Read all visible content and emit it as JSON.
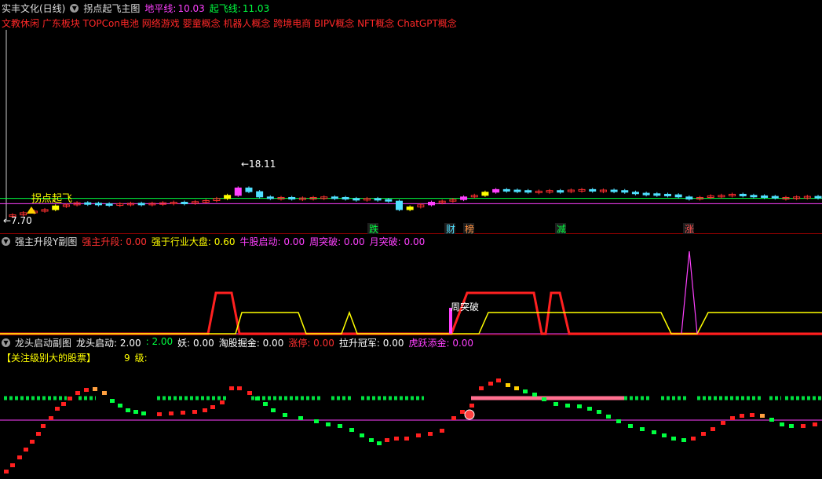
{
  "panel1": {
    "stock_title": "实丰文化(日线)",
    "indicator_name": "拐点起飞主图",
    "lbl1": "地平线:",
    "val1": "10.03",
    "lbl2": "起飞线:",
    "val2": "11.03",
    "concepts": "文教休闲 广东板块 TOPCon电池 网络游戏 婴童概念 机器人概念 跨境电商 BIPV概念 NFT概念 ChatGPT概念",
    "signal_label": "拐点起飞",
    "high_label": "18.11",
    "low_label": "7.70",
    "markers": [
      "跌",
      "财",
      "榜",
      "减",
      "涨"
    ]
  },
  "panel2": {
    "indicator_name": "强主升段Y副图",
    "fields": [
      {
        "label": "强主升段:",
        "value": "0.00",
        "color": "#ff3030"
      },
      {
        "label": "强于行业大盘:",
        "value": "0.60",
        "color": "#ffff00"
      },
      {
        "label": "牛股启动:",
        "value": "0.00",
        "color": "#ff40ff"
      },
      {
        "label": "周突破:",
        "value": "0.00",
        "color": "#ff40ff"
      },
      {
        "label": "月突破:",
        "value": "0.00",
        "color": "#ff40ff"
      }
    ],
    "annotation": "周突破"
  },
  "panel3": {
    "indicator_name": "龙头启动副图",
    "fields": [
      {
        "label": "龙头启动:",
        "value": "2.00",
        "color": "#ffffff"
      },
      {
        "label": ":",
        "value": "2.00",
        "color": "#00ff40"
      },
      {
        "label": "妖:",
        "value": "0.00",
        "color": "#ffffff"
      },
      {
        "label": "淘股掘金:",
        "value": "0.00",
        "color": "#ffffff"
      },
      {
        "label": "涨停:",
        "value": "0.00",
        "color": "#ff3030"
      },
      {
        "label": "拉升冠军:",
        "value": "0.00",
        "color": "#ffffff"
      },
      {
        "label": "虎跃添金:",
        "value": "0.00",
        "color": "#ff40ff"
      }
    ],
    "focus_text": "【关注级别大的股票】",
    "level_value": "9",
    "level_unit": "级:"
  },
  "chart_data": [
    {
      "type": "candlestick",
      "title": "拐点起飞主图",
      "ylim": [
        7.7,
        18.11
      ],
      "horizontal_lines": [
        {
          "name": "地平线",
          "value": 10.03,
          "color": "#ff40ff"
        },
        {
          "name": "起飞线",
          "value": 11.03,
          "color": "#00ff40"
        }
      ],
      "closes": [
        7.9,
        8.3,
        8.6,
        8.9,
        9.6,
        9.8,
        10.2,
        10.1,
        10.0,
        9.9,
        10.0,
        10.1,
        10.0,
        10.1,
        10.2,
        10.3,
        10.2,
        10.4,
        10.6,
        11.0,
        11.6,
        13.0,
        12.3,
        11.3,
        11.2,
        11.2,
        11.0,
        11.1,
        11.2,
        11.3,
        11.2,
        11.0,
        10.9,
        11.0,
        10.8,
        10.5,
        8.9,
        9.4,
        9.8,
        10.3,
        10.5,
        10.8,
        11.3,
        11.6,
        12.2,
        12.7,
        12.6,
        12.5,
        12.3,
        12.4,
        12.5,
        12.3,
        12.6,
        12.7,
        12.6,
        12.6,
        12.5,
        12.2,
        12.0,
        11.9,
        11.8,
        11.7,
        11.3,
        10.9,
        11.2,
        11.5,
        11.6,
        11.8,
        11.6,
        11.5,
        11.4,
        11.1,
        11.2,
        11.3,
        11.4,
        11.2
      ],
      "annotations": [
        "18.11",
        "7.70",
        "拐点起飞"
      ]
    },
    {
      "type": "line",
      "title": "强主升段Y副图",
      "series": [
        {
          "name": "强主升段",
          "color": "#ff2020"
        },
        {
          "name": "强于行业大盘",
          "color": "#ffff00"
        },
        {
          "name": "牛股启动",
          "color": "#ff40ff"
        }
      ]
    },
    {
      "type": "bar",
      "title": "龙头启动副图",
      "series": [
        {
          "name": "涨停",
          "color": "#ff2020"
        },
        {
          "name": "龙头启动",
          "color": "#00ff40"
        }
      ]
    }
  ]
}
